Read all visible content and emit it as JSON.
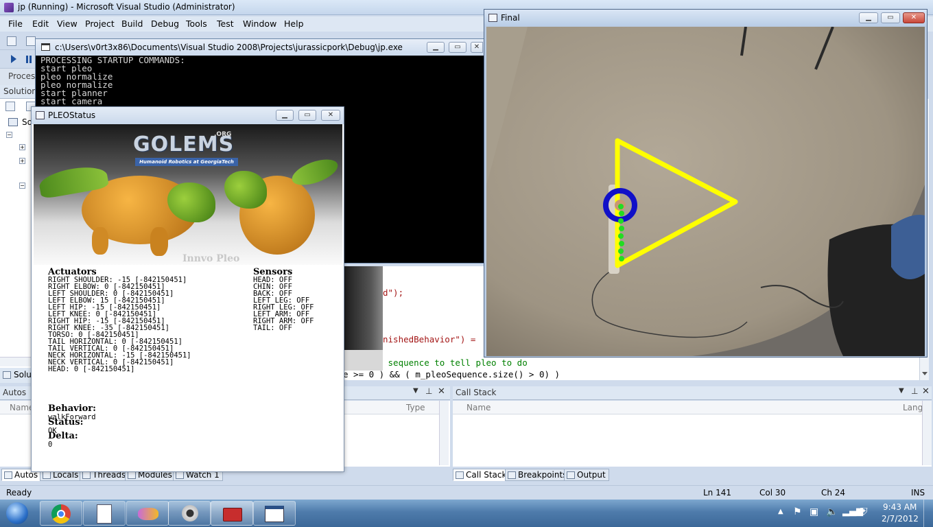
{
  "vs": {
    "title": "jp (Running) - Microsoft Visual Studio (Administrator)",
    "menu": [
      "File",
      "Edit",
      "View",
      "Project",
      "Build",
      "Debug",
      "Tools",
      "Test",
      "Window",
      "Help"
    ],
    "process_label": "Process",
    "solution_label": "Solution",
    "solution_root": "So",
    "solution_tab": "Solu",
    "code_lines": [
      "d\");",
      "nishedBehavior\") =",
      " sequence to tell pleo to do",
      "e >= 0 ) && ( m_pleoSequence.size() > 0) )"
    ]
  },
  "console": {
    "title": "c:\\Users\\v0rt3x86\\Documents\\Visual Studio 2008\\Projects\\jurassicpork\\Debug\\jp.exe",
    "lines": [
      "PROCESSING STARTUP COMMANDS:",
      "start pleo",
      "pleo normalize",
      "pleo normalize",
      "start planner",
      "start camera"
    ]
  },
  "pleo": {
    "title": "PLEOStatus",
    "logo_text": "GOLEMS",
    "logo_org": ".ORG",
    "logo_tagline": "Humanoid Robotics at GeorgiaTech",
    "watermark": "Innvo Pleo",
    "actuators_title": "Actuators",
    "actuators": [
      "RIGHT SHOULDER: -15 [-842150451]",
      "RIGHT ELBOW: 0 [-842150451]",
      "LEFT SHOULDER: 0 [-842150451]",
      "LEFT ELBOW: 15 [-842150451]",
      "LEFT HIP: -15 [-842150451]",
      "LEFT KNEE: 0 [-842150451]",
      "RIGHT HIP: -15 [-842150451]",
      "RIGHT KNEE: -35 [-842150451]",
      "TORSO: 0 [-842150451]",
      "TAIL HORIZONTAL: 0 [-842150451]",
      "TAIL VERTICAL: 0 [-842150451]",
      "NECK HORIZONTAL: -15 [-842150451]",
      "NECK VERTICAL: 0 [-842150451]",
      "HEAD: 0 [-842150451]"
    ],
    "sensors_title": "Sensors",
    "sensors": [
      "HEAD: OFF",
      "CHIN: OFF",
      "BACK: OFF",
      "LEFT LEG: OFF",
      "RIGHT LEG: OFF",
      "LEFT ARM: OFF",
      "RIGHT ARM: OFF",
      "TAIL: OFF"
    ],
    "behavior_label": "Behavior:",
    "behavior_value": "walkForward",
    "status_label": "Status:",
    "status_value": "OK",
    "delta_label": "Delta:",
    "delta_value": "0"
  },
  "final": {
    "title": "Final",
    "overlay_colors": {
      "triangle": "#ffff00",
      "circle": "#1010c8",
      "trail": "#22dd22"
    }
  },
  "autos": {
    "title": "Autos",
    "col_name": "Name",
    "col_type": "Type",
    "tabs": [
      "Autos",
      "Locals",
      "Threads",
      "Modules",
      "Watch 1"
    ]
  },
  "callstack": {
    "title": "Call Stack",
    "col_name": "Name",
    "col_lang": "Lang",
    "tabs": [
      "Call Stack",
      "Breakpoints",
      "Output"
    ]
  },
  "status": {
    "ready": "Ready",
    "ln": "Ln 141",
    "col": "Col 30",
    "ch": "Ch 24",
    "ins": "INS"
  },
  "taskbar": {
    "time": "9:43 AM",
    "date": "2/7/2012",
    "apps": [
      "chrome-icon",
      "document-icon",
      "visual-studio-icon",
      "webcam-icon",
      "toolbox-icon",
      "console-app-icon"
    ]
  }
}
